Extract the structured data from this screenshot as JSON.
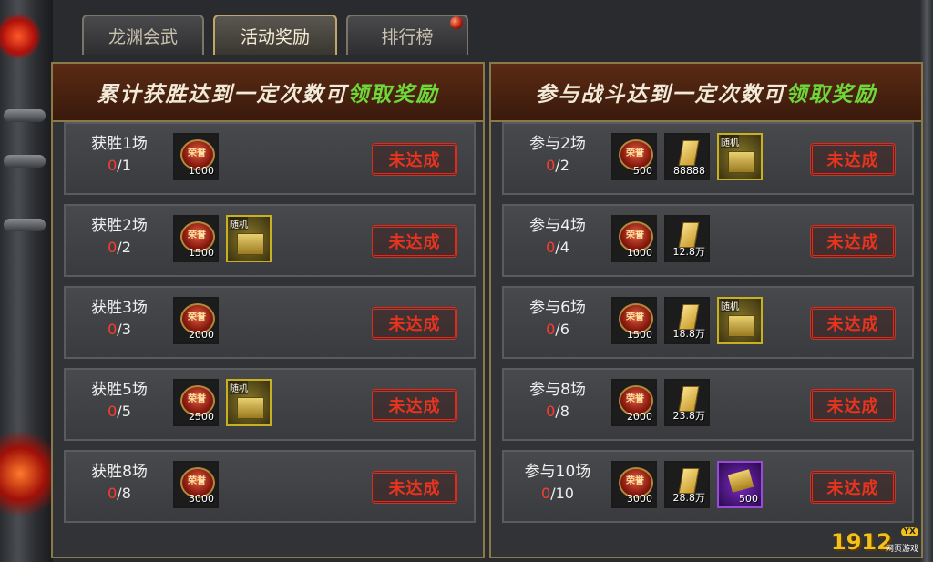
{
  "tabs": [
    {
      "label": "龙渊会武",
      "active": false
    },
    {
      "label": "活动奖励",
      "active": true
    },
    {
      "label": "排行榜",
      "active": false
    }
  ],
  "left_panel": {
    "title_main": "累计获胜达到一定次数可",
    "title_green": "领取奖励",
    "rows": [
      {
        "label": "获胜1场",
        "current": "0",
        "total": "/1",
        "items": [
          {
            "kind": "medal",
            "glyph": "荣誉",
            "qty": "1000"
          }
        ],
        "status": "未达成"
      },
      {
        "label": "获胜2场",
        "current": "0",
        "total": "/2",
        "items": [
          {
            "kind": "medal",
            "glyph": "荣誉",
            "qty": "1500"
          },
          {
            "kind": "chest",
            "tag": "随机",
            "qty": ""
          }
        ],
        "status": "未达成"
      },
      {
        "label": "获胜3场",
        "current": "0",
        "total": "/3",
        "items": [
          {
            "kind": "medal",
            "glyph": "荣誉",
            "qty": "2000"
          }
        ],
        "status": "未达成"
      },
      {
        "label": "获胜5场",
        "current": "0",
        "total": "/5",
        "items": [
          {
            "kind": "medal",
            "glyph": "荣誉",
            "qty": "2500"
          },
          {
            "kind": "chest",
            "tag": "随机",
            "qty": ""
          }
        ],
        "status": "未达成"
      },
      {
        "label": "获胜8场",
        "current": "0",
        "total": "/8",
        "items": [
          {
            "kind": "medal",
            "glyph": "荣誉",
            "qty": "3000"
          }
        ],
        "status": "未达成"
      }
    ]
  },
  "right_panel": {
    "title_main": "参与战斗达到一定次数可",
    "title_green": "领取奖励",
    "rows": [
      {
        "label": "参与2场",
        "current": "0",
        "total": "/2",
        "items": [
          {
            "kind": "medal",
            "glyph": "荣誉",
            "qty": "500"
          },
          {
            "kind": "ticket",
            "qty": "88888"
          },
          {
            "kind": "chest",
            "tag": "随机",
            "qty": ""
          }
        ],
        "status": "未达成"
      },
      {
        "label": "参与4场",
        "current": "0",
        "total": "/4",
        "items": [
          {
            "kind": "medal",
            "glyph": "荣誉",
            "qty": "1000"
          },
          {
            "kind": "ticket",
            "qty": "12.8万"
          }
        ],
        "status": "未达成"
      },
      {
        "label": "参与6场",
        "current": "0",
        "total": "/6",
        "items": [
          {
            "kind": "medal",
            "glyph": "荣誉",
            "qty": "1500"
          },
          {
            "kind": "ticket",
            "qty": "18.8万"
          },
          {
            "kind": "chest",
            "tag": "随机",
            "qty": ""
          }
        ],
        "status": "未达成"
      },
      {
        "label": "参与8场",
        "current": "0",
        "total": "/8",
        "items": [
          {
            "kind": "medal",
            "glyph": "荣誉",
            "qty": "2000"
          },
          {
            "kind": "ticket",
            "qty": "23.8万"
          }
        ],
        "status": "未达成"
      },
      {
        "label": "参与10场",
        "current": "0",
        "total": "/10",
        "items": [
          {
            "kind": "medal",
            "glyph": "荣誉",
            "qty": "3000"
          },
          {
            "kind": "ticket",
            "qty": "28.8万"
          },
          {
            "kind": "scroll",
            "qty": "500"
          }
        ],
        "status": "未达成"
      }
    ]
  },
  "logo": {
    "number": "1912",
    "badge": "YX",
    "sub": "网页游戏"
  }
}
